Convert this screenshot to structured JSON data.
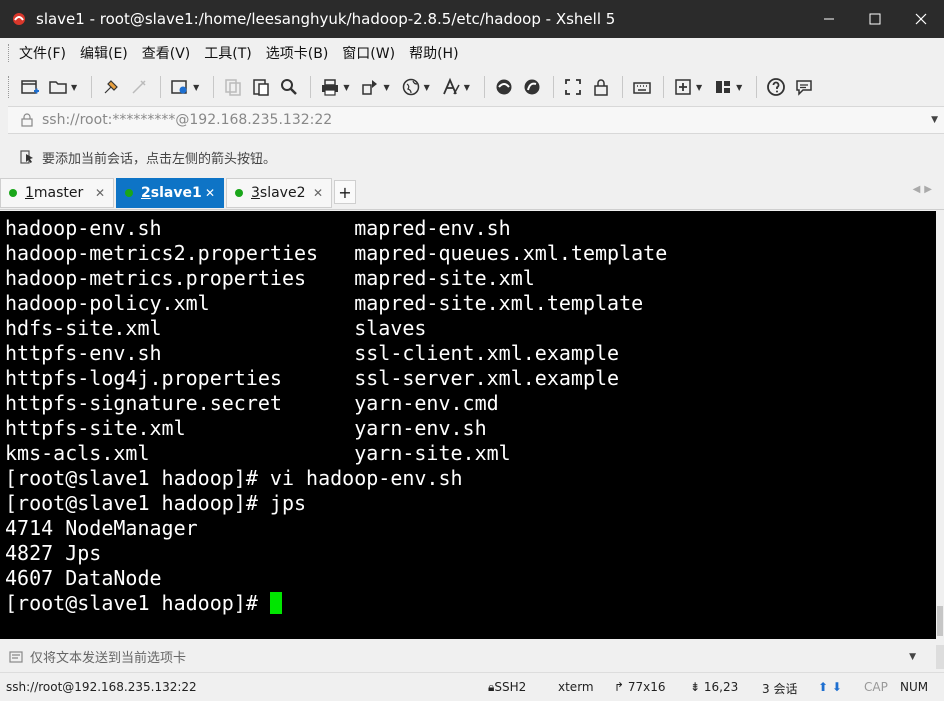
{
  "window": {
    "title": "slave1 - root@slave1:/home/leesanghyuk/hadoop-2.8.5/etc/hadoop - Xshell 5"
  },
  "menu": [
    "文件(F)",
    "编辑(E)",
    "查看(V)",
    "工具(T)",
    "选项卡(B)",
    "窗口(W)",
    "帮助(H)"
  ],
  "address": {
    "value": "ssh://root:*********@192.168.235.132:22"
  },
  "hint": {
    "text": "要添加当前会话，点击左侧的箭头按钮。"
  },
  "tabs": [
    {
      "num": "1",
      "name": " master",
      "active": false
    },
    {
      "num": "2",
      "name": " slave1",
      "active": true
    },
    {
      "num": "3",
      "name": " slave2",
      "active": false
    }
  ],
  "terminal": {
    "lines": [
      "hadoop-env.sh                mapred-env.sh",
      "hadoop-metrics2.properties   mapred-queues.xml.template",
      "hadoop-metrics.properties    mapred-site.xml",
      "hadoop-policy.xml            mapred-site.xml.template",
      "hdfs-site.xml                slaves",
      "httpfs-env.sh                ssl-client.xml.example",
      "httpfs-log4j.properties      ssl-server.xml.example",
      "httpfs-signature.secret      yarn-env.cmd",
      "httpfs-site.xml              yarn-env.sh",
      "kms-acls.xml                 yarn-site.xml",
      "[root@slave1 hadoop]# vi hadoop-env.sh",
      "[root@slave1 hadoop]# jps",
      "4714 NodeManager",
      "4827 Jps",
      "4607 DataNode"
    ],
    "prompt": "[root@slave1 hadoop]# ",
    "cursor_color": "#00e600"
  },
  "sendbar": {
    "text": "仅将文本发送到当前选项卡"
  },
  "status": {
    "connection": "ssh://root@192.168.235.132:22",
    "protocol": "SSH2",
    "terminal_type": "xterm",
    "size": "77x16",
    "position": "16,23",
    "sessions": "3 会话",
    "caps": "CAP",
    "num": "NUM"
  },
  "colors": {
    "active_tab": "#0e74c6",
    "tab_dot": "#1aa61a",
    "titlebar": "#2b2b2b"
  }
}
